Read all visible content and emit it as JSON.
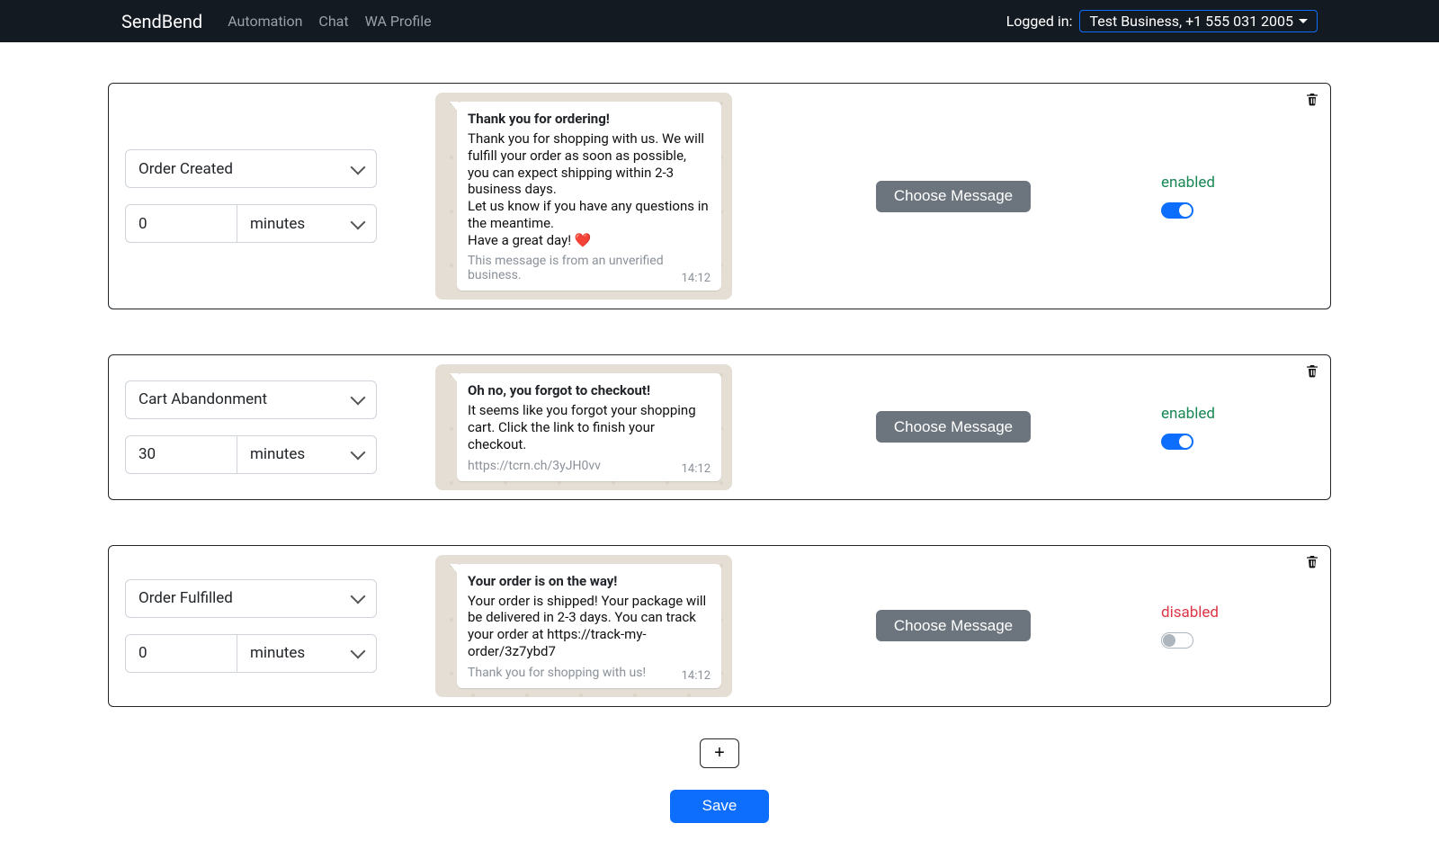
{
  "nav": {
    "brand": "SendBend",
    "links": [
      "Automation",
      "Chat",
      "WA Profile"
    ],
    "logged_in_label": "Logged in:",
    "account": "Test Business, +1 555 031 2005"
  },
  "common": {
    "choose_message": "Choose Message",
    "add": "+",
    "save": "Save",
    "enabled": "enabled",
    "disabled": "disabled",
    "minutes": "minutes"
  },
  "rules": [
    {
      "trigger": "Order Created",
      "delay_value": "0",
      "delay_unit": "minutes",
      "enabled": true,
      "message": {
        "title": "Thank you for ordering!",
        "body": "Thank you for shopping with us. We will fulfill your order as soon as possible,\nyou can expect shipping within 2-3 business days.\nLet us know if you have any questions in the meantime.\nHave a great day! ❤️",
        "footer": "This message is from an unverified business.",
        "time": "14:12"
      }
    },
    {
      "trigger": "Cart Abandonment",
      "delay_value": "30",
      "delay_unit": "minutes",
      "enabled": true,
      "message": {
        "title": "Oh no, you forgot to checkout!",
        "body": "It seems like you forgot your shopping cart. Click the link to finish your checkout.",
        "footer": "https://tcrn.ch/3yJH0vv",
        "time": "14:12"
      }
    },
    {
      "trigger": "Order Fulfilled",
      "delay_value": "0",
      "delay_unit": "minutes",
      "enabled": false,
      "message": {
        "title": "Your order is on the way!",
        "body": "Your order is shipped! Your package will be delivered in 2-3 days. You can track your order at https://track-my-order/3z7ybd7",
        "footer": "Thank you for shopping with us!",
        "time": "14:12"
      }
    }
  ]
}
